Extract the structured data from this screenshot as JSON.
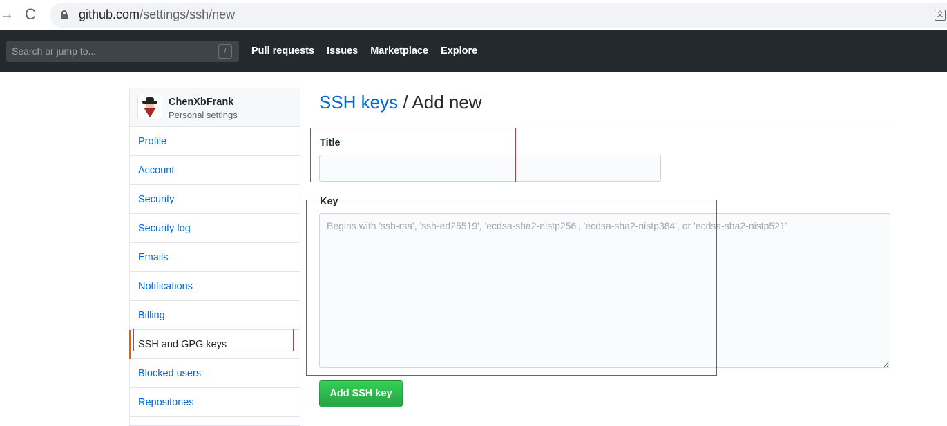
{
  "browser": {
    "url_host": "github.com",
    "url_path": "/settings/ssh/new",
    "back_icon": "arrow-right-icon",
    "reload_glyph": "C",
    "translate_glyph": "文"
  },
  "header": {
    "search_placeholder": "Search or jump to...",
    "search_shortcut": "/",
    "nav": [
      "Pull requests",
      "Issues",
      "Marketplace",
      "Explore"
    ],
    "bg_color": "#24292e"
  },
  "sidebar": {
    "username": "ChenXbFrank",
    "subtitle": "Personal settings",
    "items": [
      {
        "label": "Profile"
      },
      {
        "label": "Account"
      },
      {
        "label": "Security"
      },
      {
        "label": "Security log"
      },
      {
        "label": "Emails"
      },
      {
        "label": "Notifications"
      },
      {
        "label": "Billing"
      },
      {
        "label": "SSH and GPG keys",
        "selected": true
      },
      {
        "label": "Blocked users"
      },
      {
        "label": "Repositories"
      }
    ]
  },
  "main": {
    "breadcrumb_link": "SSH keys",
    "breadcrumb_sep": " / ",
    "breadcrumb_current": "Add new",
    "title_label": "Title",
    "title_value": "",
    "key_label": "Key",
    "key_placeholder": "Begins with 'ssh-rsa', 'ssh-ed25519', 'ecdsa-sha2-nistp256', 'ecdsa-sha2-nistp384', or 'ecdsa-sha2-nistp521'",
    "submit_label": "Add SSH key",
    "accent_color": "#0366d6",
    "button_color": "#28a745"
  }
}
